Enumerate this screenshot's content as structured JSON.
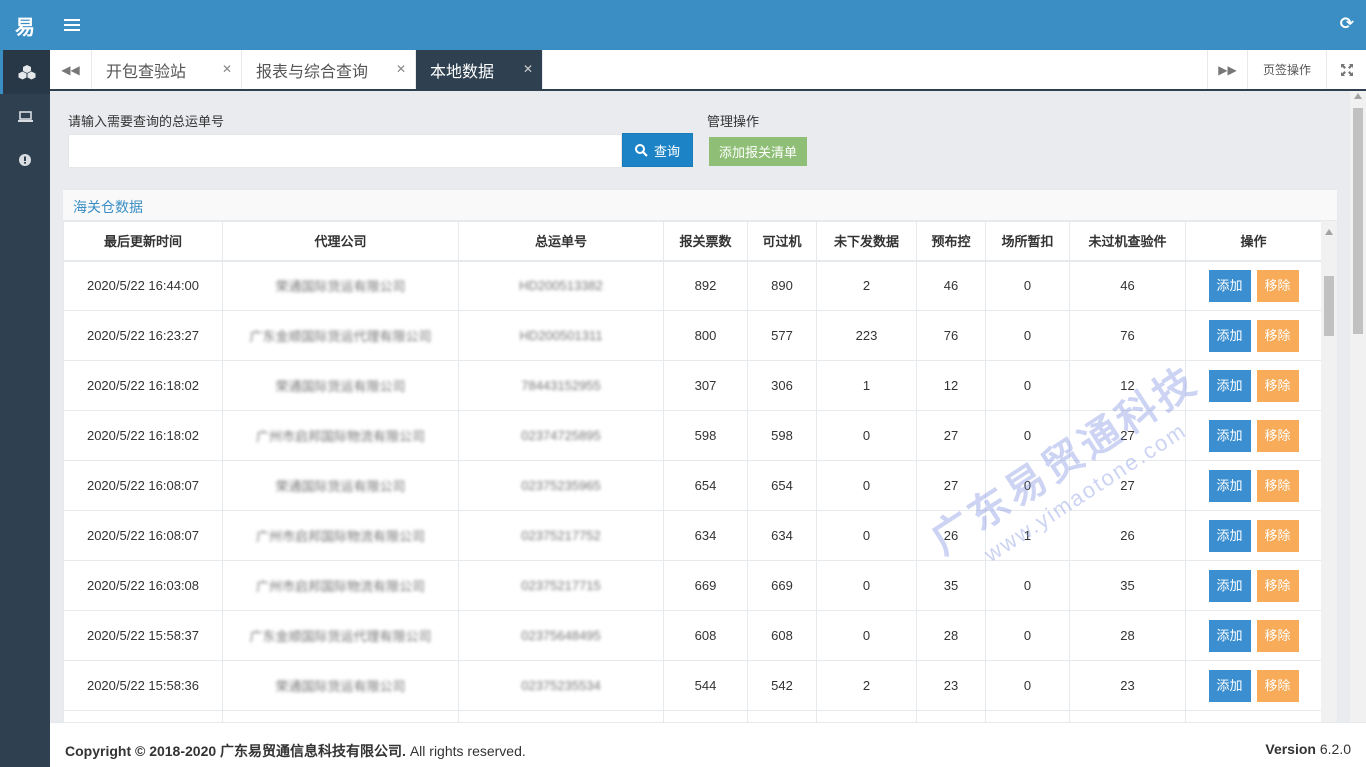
{
  "sidebar": {
    "logo": "易",
    "icons": [
      "cubes-icon",
      "laptop-icon",
      "alert-circle-icon"
    ]
  },
  "topbar": {
    "menu_icon": "hamburger-icon",
    "refresh_icon": "refresh-icon"
  },
  "tabs": {
    "prev_icon": "backward-icon",
    "next_icon": "forward-icon",
    "fullscreen_icon": "expand-icon",
    "items": [
      {
        "label": "开包查验站",
        "active": false
      },
      {
        "label": "报表与综合查询",
        "active": false
      },
      {
        "label": "本地数据",
        "active": true
      }
    ],
    "page_ops_label": "页签操作"
  },
  "search": {
    "label": "请输入需要查询的总运单号",
    "value": "",
    "placeholder": "",
    "button_label": "查询"
  },
  "management": {
    "label": "管理操作",
    "add_button_label": "添加报关清单"
  },
  "panel": {
    "title": "海关仓数据",
    "columns": [
      "最后更新时间",
      "代理公司",
      "总运单号",
      "报关票数",
      "可过机",
      "未下发数据",
      "预布控",
      "场所暂扣",
      "未过机查验件",
      "操作"
    ],
    "action_add_label": "添加",
    "action_remove_label": "移除",
    "rows": [
      {
        "time": "2020/5/22 16:44:00",
        "company": "荣通国际货运有限公司",
        "awb": "HD200513382",
        "declarations": "892",
        "passable": "890",
        "undelivered": "2",
        "pre_control": "46",
        "detained": "0",
        "unscanned": "46"
      },
      {
        "time": "2020/5/22 16:23:27",
        "company": "广东金顺国际货运代理有限公司",
        "awb": "HD200501311",
        "declarations": "800",
        "passable": "577",
        "undelivered": "223",
        "pre_control": "76",
        "detained": "0",
        "unscanned": "76"
      },
      {
        "time": "2020/5/22 16:18:02",
        "company": "荣通国际货运有限公司",
        "awb": "78443152955",
        "declarations": "307",
        "passable": "306",
        "undelivered": "1",
        "pre_control": "12",
        "detained": "0",
        "unscanned": "12"
      },
      {
        "time": "2020/5/22 16:18:02",
        "company": "广州市启邦国际物流有限公司",
        "awb": "02374725895",
        "declarations": "598",
        "passable": "598",
        "undelivered": "0",
        "pre_control": "27",
        "detained": "0",
        "unscanned": "27"
      },
      {
        "time": "2020/5/22 16:08:07",
        "company": "荣通国际货运有限公司",
        "awb": "02375235965",
        "declarations": "654",
        "passable": "654",
        "undelivered": "0",
        "pre_control": "27",
        "detained": "0",
        "unscanned": "27"
      },
      {
        "time": "2020/5/22 16:08:07",
        "company": "广州市启邦国际物流有限公司",
        "awb": "02375217752",
        "declarations": "634",
        "passable": "634",
        "undelivered": "0",
        "pre_control": "26",
        "detained": "1",
        "unscanned": "26"
      },
      {
        "time": "2020/5/22 16:03:08",
        "company": "广州市启邦国际物流有限公司",
        "awb": "02375217715",
        "declarations": "669",
        "passable": "669",
        "undelivered": "0",
        "pre_control": "35",
        "detained": "0",
        "unscanned": "35"
      },
      {
        "time": "2020/5/22 15:58:37",
        "company": "广东金顺国际货运代理有限公司",
        "awb": "02375648495",
        "declarations": "608",
        "passable": "608",
        "undelivered": "0",
        "pre_control": "28",
        "detained": "0",
        "unscanned": "28"
      },
      {
        "time": "2020/5/22 15:58:36",
        "company": "荣通国际货运有限公司",
        "awb": "02375235534",
        "declarations": "544",
        "passable": "542",
        "undelivered": "2",
        "pre_control": "23",
        "detained": "0",
        "unscanned": "23"
      }
    ]
  },
  "watermark": {
    "line1": "广东易贸通科技",
    "line2": "www.yimaotone.com"
  },
  "footer": {
    "copyright_prefix": "Copyright © 2018-2020 广东易贸通信息科技有限公司.",
    "copyright_suffix": "All rights reserved.",
    "version_label": "Version",
    "version_number": "6.2.0"
  },
  "colors": {
    "primary": "#3a8ec4",
    "sidebar": "#2f4050",
    "add_green": "#8fbf77",
    "remove_orange": "#f8ac59",
    "action_blue": "#3b8fd0"
  }
}
